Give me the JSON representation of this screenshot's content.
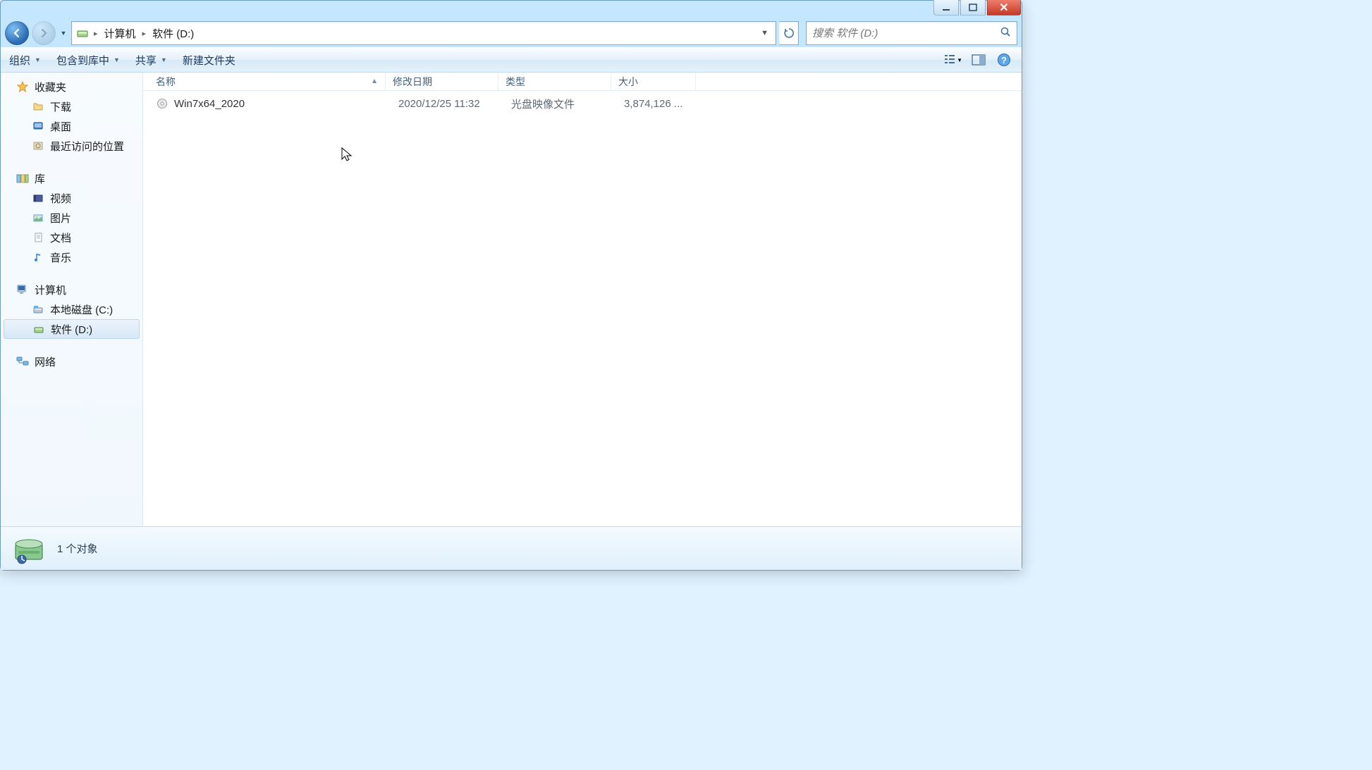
{
  "nav": {
    "breadcrumbs": [
      "计算机",
      "软件 (D:)"
    ]
  },
  "search": {
    "placeholder": "搜索 软件 (D:)"
  },
  "toolbar": {
    "organize": "组织",
    "include": "包含到库中",
    "share": "共享",
    "newfolder": "新建文件夹"
  },
  "sidebar": {
    "favorites": {
      "label": "收藏夹",
      "items": [
        {
          "label": "下载"
        },
        {
          "label": "桌面"
        },
        {
          "label": "最近访问的位置"
        }
      ]
    },
    "libraries": {
      "label": "库",
      "items": [
        {
          "label": "视频"
        },
        {
          "label": "图片"
        },
        {
          "label": "文档"
        },
        {
          "label": "音乐"
        }
      ]
    },
    "computer": {
      "label": "计算机",
      "items": [
        {
          "label": "本地磁盘 (C:)"
        },
        {
          "label": "软件 (D:)",
          "selected": true
        }
      ]
    },
    "network": {
      "label": "网络"
    }
  },
  "columns": {
    "name": "名称",
    "date": "修改日期",
    "type": "类型",
    "size": "大小"
  },
  "files": [
    {
      "name": "Win7x64_2020",
      "date": "2020/12/25 11:32",
      "type": "光盘映像文件",
      "size": "3,874,126 ..."
    }
  ],
  "status": {
    "text": "1 个对象"
  }
}
